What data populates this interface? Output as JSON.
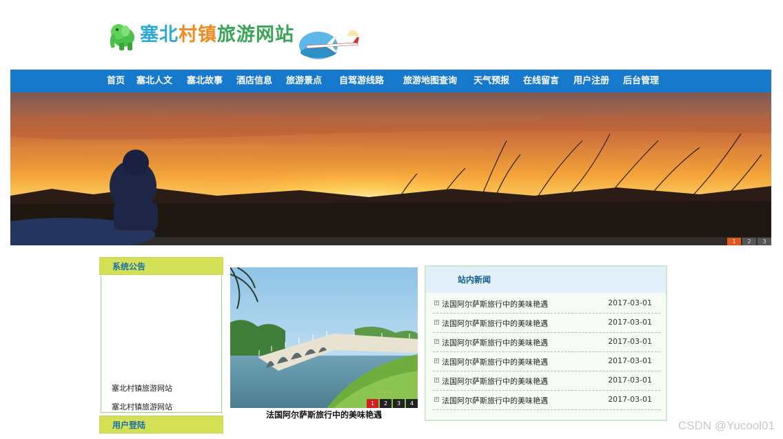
{
  "header": {
    "logo_text_a": "塞北",
    "logo_text_b": "村镇",
    "logo_text_c": "旅游网站",
    "logo_icon": "elephant-icon",
    "decor_image": "airplane-illustration"
  },
  "nav": {
    "items": [
      {
        "label": "首页"
      },
      {
        "label": "塞北人文"
      },
      {
        "label": "塞北故事"
      },
      {
        "label": "酒店信息"
      },
      {
        "label": "旅游景点"
      },
      {
        "label": "自驾游线路"
      },
      {
        "label": "旅游地图查询"
      },
      {
        "label": "天气预报"
      },
      {
        "label": "在线留言"
      },
      {
        "label": "用户注册"
      },
      {
        "label": "后台管理"
      }
    ],
    "bg_color": "#1679cc"
  },
  "banner": {
    "image": "sunset-grassland-with-person",
    "pager": [
      "1",
      "2",
      "3"
    ],
    "active_page": "1"
  },
  "notice": {
    "title": "系统公告",
    "items": [
      "塞北村镇旅游网站",
      "塞北村镇旅游网站"
    ]
  },
  "login": {
    "title": "用户登陆"
  },
  "photo": {
    "image": "stone-arch-bridge-over-lake",
    "overlay_text": "~ ~ ~",
    "pager": [
      "1",
      "2",
      "3",
      "4"
    ],
    "active_page": "1",
    "caption": "法国阿尔萨斯旅行中的美味艳遇"
  },
  "news": {
    "title": "站内新闻",
    "items": [
      {
        "title": "法国阿尔萨斯旅行中的美味艳遇",
        "date": "2017-03-01"
      },
      {
        "title": "法国阿尔萨斯旅行中的美味艳遇",
        "date": "2017-03-01"
      },
      {
        "title": "法国阿尔萨斯旅行中的美味艳遇",
        "date": "2017-03-01"
      },
      {
        "title": "法国阿尔萨斯旅行中的美味艳遇",
        "date": "2017-03-01"
      },
      {
        "title": "法国阿尔萨斯旅行中的美味艳遇",
        "date": "2017-03-01"
      },
      {
        "title": "法国阿尔萨斯旅行中的美味艳遇",
        "date": "2017-03-01"
      }
    ]
  },
  "watermark": "CSDN @Yucool01"
}
